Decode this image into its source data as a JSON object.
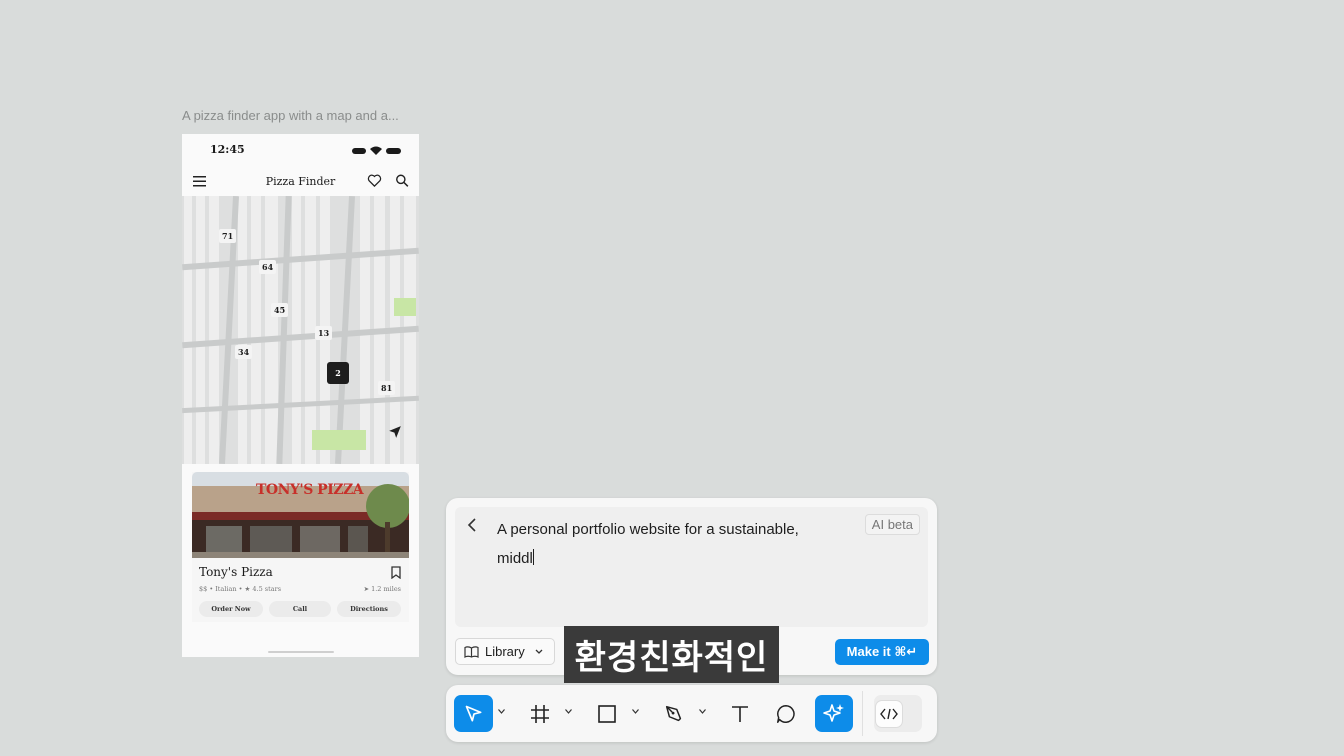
{
  "canvas": {
    "frame_caption": "A pizza finder app with a map and a..."
  },
  "phone": {
    "status_time": "12:45",
    "app_title": "Pizza Finder",
    "icons": {
      "menu": "hamburger-menu-icon",
      "favorites": "heart-icon",
      "search": "search-icon",
      "locate": "navigation-arrow-icon",
      "bookmark": "bookmark-icon"
    },
    "map_pins": [
      "71",
      "64",
      "45",
      "13",
      "34",
      "2",
      "81"
    ],
    "selected_pin": "2",
    "card": {
      "sign_text": "TONY'S PIZZA",
      "name": "Tony's Pizza",
      "meta": "$$ • Italian • ★ 4.5 stars",
      "distance": "➤ 1.2 miles",
      "buttons": [
        "Order Now",
        "Call",
        "Directions"
      ]
    }
  },
  "prompt": {
    "text_line1": "A personal portfolio website for a sustainable,",
    "text_line2": "middl",
    "badge": "AI beta",
    "library_label": "Library",
    "make_label": "Make it ⌘↵"
  },
  "subtitle": "환경친화적인",
  "toolbar": {
    "tools": [
      "move-tool",
      "frame-tool",
      "rectangle-tool",
      "pen-tool",
      "text-tool",
      "comment-tool",
      "ai-tool",
      "dev-mode-tool"
    ],
    "active": [
      "move-tool",
      "ai-tool"
    ]
  },
  "colors": {
    "accent": "#0d8ce9",
    "canvas": "#d9dcdb",
    "map_green": "#c8e6a5"
  }
}
